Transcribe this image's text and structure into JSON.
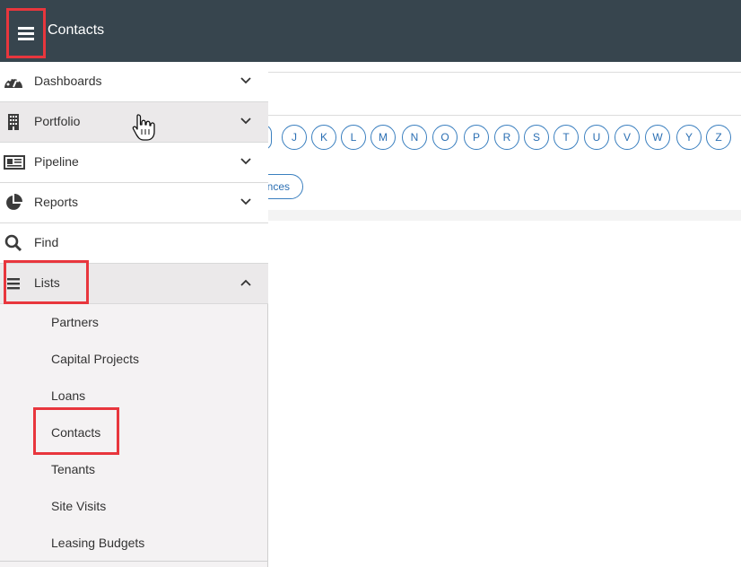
{
  "header": {
    "title": "Contacts",
    "menu_icon": "hamburger-icon",
    "background": "#37454e"
  },
  "alphabet": [
    "J",
    "K",
    "L",
    "M",
    "N",
    "O",
    "P",
    "R",
    "S",
    "T",
    "U",
    "V",
    "W",
    "Y",
    "Z"
  ],
  "partial_button_text": "nces",
  "sidemenu": {
    "items": [
      {
        "label": "Dashboards",
        "icon": "speedometer-icon",
        "chevron": "chevron-down-icon"
      },
      {
        "label": "Portfolio",
        "icon": "building-icon",
        "chevron": "chevron-down-icon"
      },
      {
        "label": "Pipeline",
        "icon": "newspaper-icon",
        "chevron": "chevron-down-icon"
      },
      {
        "label": "Reports",
        "icon": "pie-chart-icon",
        "chevron": "chevron-down-icon"
      },
      {
        "label": "Find",
        "icon": "search-icon"
      },
      {
        "label": "Lists",
        "icon": "list-icon",
        "chevron": "chevron-up-icon"
      }
    ],
    "lists_subitems": [
      "Partners",
      "Capital Projects",
      "Loans",
      "Contacts",
      "Tenants",
      "Site Visits",
      "Leasing Budgets"
    ]
  },
  "colors": {
    "highlight": "#e8363d",
    "accent_blue": "#2b6fb3"
  }
}
